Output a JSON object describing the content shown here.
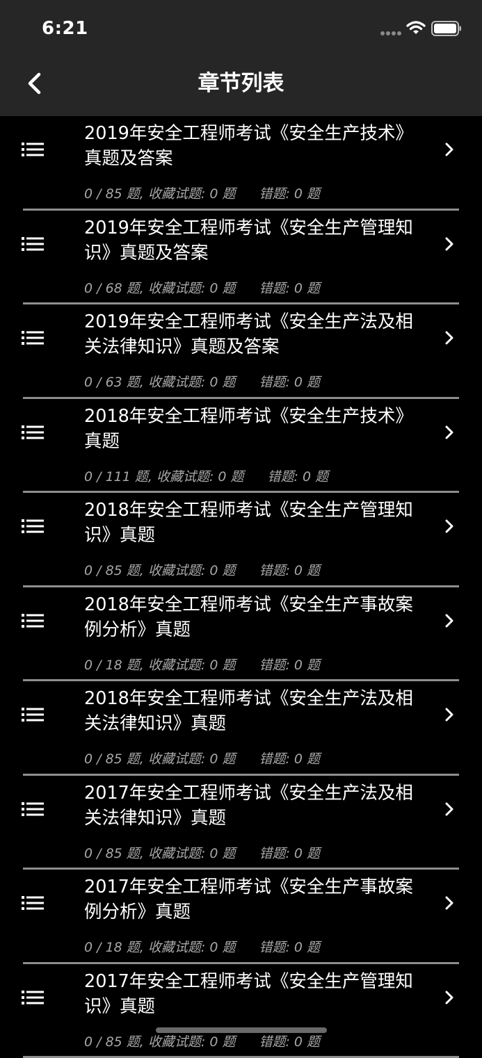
{
  "status_bar": {
    "time": "6:21"
  },
  "nav": {
    "title": "章节列表",
    "back_icon": "chevron-left-icon"
  },
  "colors": {
    "header_bg": "#262626",
    "page_bg": "#000000",
    "meta_text": "#a8a8a8",
    "divider": "#8e8e8e"
  },
  "chapters": [
    {
      "title": "2019年安全工程师考试《安全生产技术》真题及答案",
      "progress": "0 / 85 题,",
      "favorites": "收藏试题: 0 题",
      "errors": "错题: 0 题"
    },
    {
      "title": "2019年安全工程师考试《安全生产管理知识》真题及答案",
      "progress": "0 / 68 题,",
      "favorites": "收藏试题: 0 题",
      "errors": "错题: 0 题"
    },
    {
      "title": "2019年安全工程师考试《安全生产法及相关法律知识》真题及答案",
      "progress": "0 / 63 题,",
      "favorites": "收藏试题: 0 题",
      "errors": "错题: 0 题"
    },
    {
      "title": "2018年安全工程师考试《安全生产技术》真题",
      "progress": "0 / 111 题,",
      "favorites": "收藏试题: 0 题",
      "errors": "错题: 0 题"
    },
    {
      "title": "2018年安全工程师考试《安全生产管理知识》真题",
      "progress": "0 / 85 题,",
      "favorites": "收藏试题: 0 题",
      "errors": "错题: 0 题"
    },
    {
      "title": "2018年安全工程师考试《安全生产事故案例分析》真题",
      "progress": "0 / 18 题,",
      "favorites": "收藏试题: 0 题",
      "errors": "错题: 0 题"
    },
    {
      "title": "2018年安全工程师考试《安全生产法及相关法律知识》真题",
      "progress": "0 / 85 题,",
      "favorites": "收藏试题: 0 题",
      "errors": "错题: 0 题"
    },
    {
      "title": "2017年安全工程师考试《安全生产法及相关法律知识》真题",
      "progress": "0 / 85 题,",
      "favorites": "收藏试题: 0 题",
      "errors": "错题: 0 题"
    },
    {
      "title": "2017年安全工程师考试《安全生产事故案例分析》真题",
      "progress": "0 / 18 题,",
      "favorites": "收藏试题: 0 题",
      "errors": "错题: 0 题"
    },
    {
      "title": "2017年安全工程师考试《安全生产管理知识》真题",
      "progress": "0 / 85 题,",
      "favorites": "收藏试题: 0 题",
      "errors": "错题: 0 题"
    }
  ]
}
